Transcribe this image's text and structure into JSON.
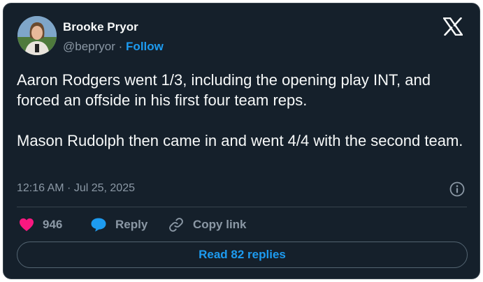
{
  "author": {
    "name": "Brooke Pryor",
    "handle": "@bepryor",
    "separator": "·",
    "follow_label": "Follow"
  },
  "tweet": {
    "paragraphs": [
      "Aaron Rodgers went 1/3, including the opening play INT, and forced an offside in his first four team reps.",
      "Mason Rudolph then came in and went 4/4 with the second team."
    ],
    "timestamp": "12:16 AM · Jul 25, 2025"
  },
  "actions": {
    "like_count": "946",
    "reply_label": "Reply",
    "copy_label": "Copy link"
  },
  "footer": {
    "read_replies_label": "Read 82 replies"
  },
  "icons": {
    "logo": "x-logo-icon",
    "info": "info-icon",
    "like": "heart-icon",
    "reply": "speech-bubble-icon",
    "copy": "link-icon"
  },
  "colors": {
    "background": "#15202b",
    "border": "#38444d",
    "text_primary": "#f7f9f9",
    "text_secondary": "#8b98a5",
    "accent": "#1d9bf0",
    "like": "#f91880"
  }
}
